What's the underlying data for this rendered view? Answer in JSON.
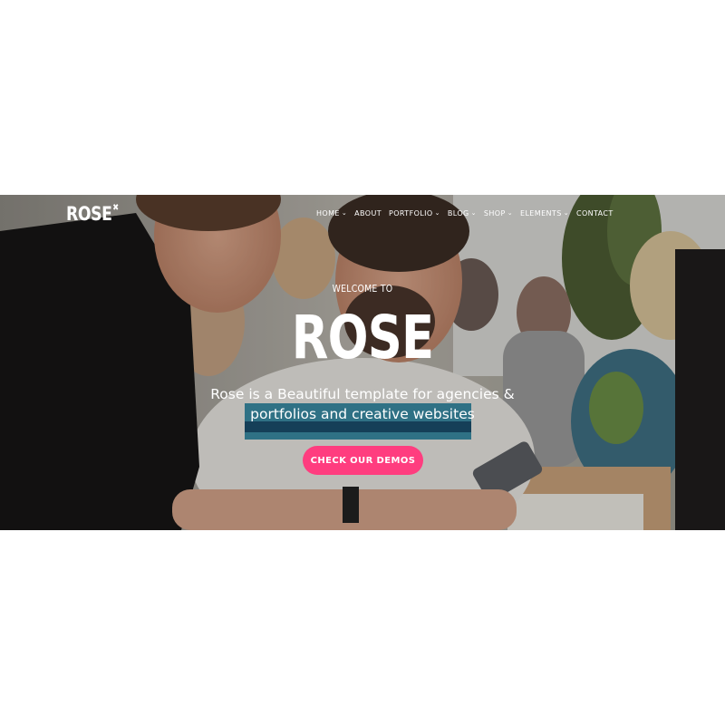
{
  "brand": {
    "name": "ROSE",
    "mark": "✖"
  },
  "nav": [
    {
      "label": "HOME",
      "dropdown": true
    },
    {
      "label": "ABOUT",
      "dropdown": false
    },
    {
      "label": "PORTFOLIO",
      "dropdown": true
    },
    {
      "label": "BLOG",
      "dropdown": true
    },
    {
      "label": "SHOP",
      "dropdown": true
    },
    {
      "label": "ELEMENTS",
      "dropdown": true
    },
    {
      "label": "CONTACT",
      "dropdown": false
    }
  ],
  "hero": {
    "welcome": "WELCOME TO",
    "title": "ROSE",
    "subtitle": "Rose is a Beautiful template for agencies & portfolios and creative websites",
    "cta_label": "CHECK OUR DEMOS"
  },
  "colors": {
    "accent": "#ff3d7f",
    "text": "#ffffff"
  },
  "icons": {
    "dropdown": "chevron-down-icon",
    "brand_mark": "x-mark-icon"
  }
}
